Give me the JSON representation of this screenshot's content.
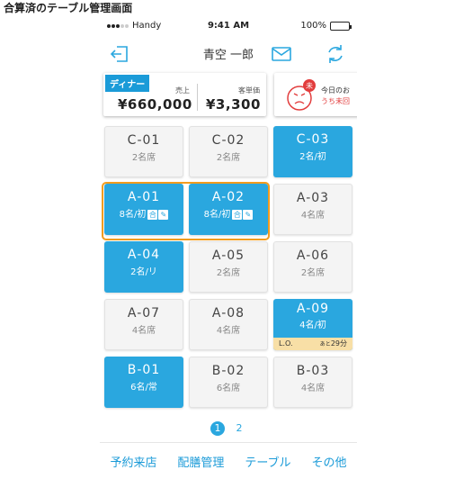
{
  "caption": "合算済のテーブル管理画面",
  "status": {
    "carrier": "Handy",
    "time": "9:41 AM",
    "battery": "100%",
    "battery_level": 1.0
  },
  "header": {
    "title": "青空 一郎",
    "icons": [
      "logout-icon",
      "mail-icon",
      "refresh-icon"
    ]
  },
  "sales": {
    "meal_badge": "ディナー",
    "sales_label": "売上",
    "sales_value": "¥660,000",
    "avg_label": "客単価",
    "avg_value": "¥3,300"
  },
  "review": {
    "face_badge": "未",
    "label": "今日のお",
    "sub": "うち未回"
  },
  "tables": [
    {
      "name": "C-01",
      "sub": "2名席",
      "state": "empty"
    },
    {
      "name": "C-02",
      "sub": "2名席",
      "state": "empty"
    },
    {
      "name": "C-03",
      "sub": "2名/初",
      "state": "occupied"
    },
    {
      "name": "A-01",
      "sub": "8名/初",
      "state": "occupied",
      "tags": [
        "合",
        "✎"
      ]
    },
    {
      "name": "A-02",
      "sub": "8名/初",
      "state": "occupied",
      "tags": [
        "合",
        "✎"
      ]
    },
    {
      "name": "A-03",
      "sub": "4名席",
      "state": "empty"
    },
    {
      "name": "A-04",
      "sub": "2名/リ",
      "state": "occupied"
    },
    {
      "name": "A-05",
      "sub": "2名席",
      "state": "empty"
    },
    {
      "name": "A-06",
      "sub": "2名席",
      "state": "empty"
    },
    {
      "name": "A-07",
      "sub": "4名席",
      "state": "empty"
    },
    {
      "name": "A-08",
      "sub": "4名席",
      "state": "empty"
    },
    {
      "name": "A-09",
      "sub": "4名/初",
      "state": "occupied",
      "lo": {
        "label": "L.O.",
        "prefix": "あと",
        "value": "29分"
      }
    },
    {
      "name": "B-01",
      "sub": "6名/常",
      "state": "occupied"
    },
    {
      "name": "B-02",
      "sub": "6名席",
      "state": "empty"
    },
    {
      "name": "B-03",
      "sub": "4名席",
      "state": "empty"
    }
  ],
  "pager": {
    "pages": [
      "1",
      "2"
    ],
    "current": "1"
  },
  "tabs": [
    "予約来店",
    "配膳管理",
    "テーブル",
    "その他"
  ],
  "colors": {
    "accent": "#2aa7df",
    "merge_outline": "#f29c1e",
    "lo_bar": "#f8dfa6",
    "alert": "#e23d3d"
  }
}
